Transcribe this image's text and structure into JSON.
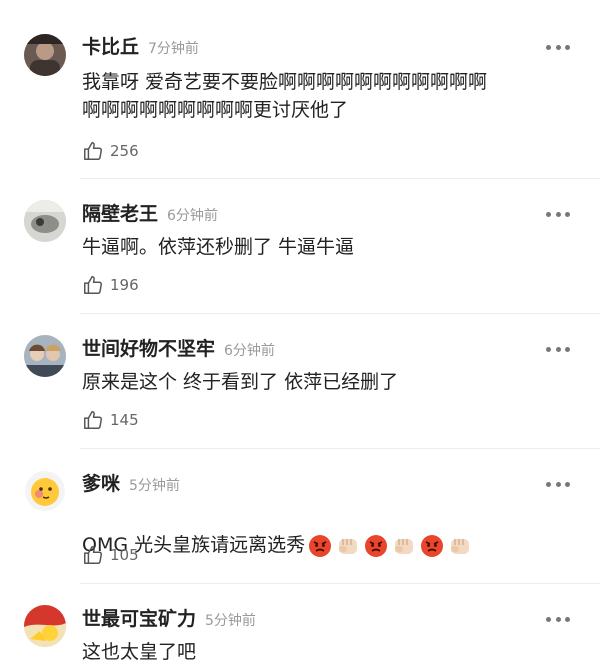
{
  "comments": [
    {
      "user": "卡比丘",
      "time": "7分钟前",
      "text": "我靠呀 爱奇艺要不要脸啊啊啊啊啊啊啊啊啊啊啊\n啊啊啊啊啊啊啊啊啊更讨厌他了",
      "likes": "256",
      "avatar_icon": "dark-photo-avatar-icon"
    },
    {
      "user": "隔壁老王",
      "time": "6分钟前",
      "text": "牛逼啊。依萍还秒删了 牛逼牛逼",
      "likes": "196",
      "avatar_icon": "grey-photo-avatar-icon"
    },
    {
      "user": "世间好物不坚牢",
      "time": "6分钟前",
      "text": "原来是这个  终于看到了  依萍已经删了",
      "likes": "145",
      "avatar_icon": "two-faces-avatar-icon"
    },
    {
      "user": "爹咪",
      "time": "5分钟前",
      "text": "OMG 光头皇族请远离选秀",
      "emojis": [
        "angry-face-icon",
        "fist-icon",
        "angry-face-icon",
        "fist-icon",
        "angry-face-icon",
        "fist-icon"
      ],
      "likes": "105",
      "avatar_icon": "yellow-face-avatar-icon"
    },
    {
      "user": "世最可宝矿力",
      "time": "5分钟前",
      "text": "这也太皇了吧",
      "avatar_icon": "red-yellow-avatar-icon"
    }
  ],
  "icons": {
    "more": "more-options-icon",
    "like": "thumbs-up-icon"
  },
  "colors": {
    "name": "#222222",
    "time": "#9a9a9a",
    "likes": "#666666",
    "divider": "#ececec",
    "angry": "#e8452c"
  }
}
